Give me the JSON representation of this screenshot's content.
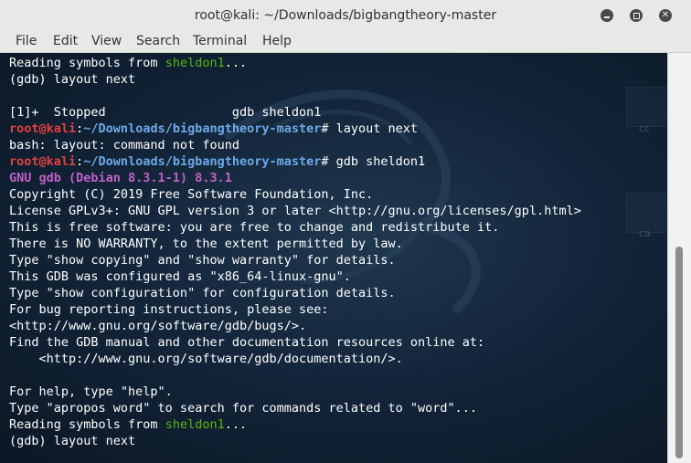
{
  "window": {
    "title": "root@kali: ~/Downloads/bigbangtheory-master",
    "controls": {
      "minimize_icon": "minimize-icon",
      "maximize_icon": "maximize-icon",
      "close_icon": "close-icon"
    }
  },
  "menu": {
    "items": [
      "File",
      "Edit",
      "View",
      "Search",
      "Terminal",
      "Help"
    ]
  },
  "desktop": {
    "labels": [
      "cc",
      "ca"
    ]
  },
  "terminal": {
    "lines": [
      [
        {
          "t": "Reading symbols from ",
          "c": "w"
        },
        {
          "t": "sheldon1",
          "c": "g"
        },
        {
          "t": "...",
          "c": "w"
        }
      ],
      [
        {
          "t": "(gdb) layout next",
          "c": "w"
        }
      ],
      [
        {
          "t": "",
          "c": "w"
        }
      ],
      [
        {
          "t": "[1]+  Stopped                 gdb sheldon1",
          "c": "w"
        }
      ],
      [
        {
          "t": "root@kali",
          "c": "r"
        },
        {
          "t": ":",
          "c": "w"
        },
        {
          "t": "~/Downloads/bigbangtheory-master",
          "c": "b"
        },
        {
          "t": "# layout next",
          "c": "w"
        }
      ],
      [
        {
          "t": "bash: layout: command not found",
          "c": "w"
        }
      ],
      [
        {
          "t": "root@kali",
          "c": "r"
        },
        {
          "t": ":",
          "c": "w"
        },
        {
          "t": "~/Downloads/bigbangtheory-master",
          "c": "b"
        },
        {
          "t": "# gdb sheldon1",
          "c": "w"
        }
      ],
      [
        {
          "t": "GNU gdb (Debian 8.3.1-1) 8.3.1",
          "c": "p"
        }
      ],
      [
        {
          "t": "Copyright (C) 2019 Free Software Foundation, Inc.",
          "c": "w"
        }
      ],
      [
        {
          "t": "License GPLv3+: GNU GPL version 3 or later <http://gnu.org/licenses/gpl.html>",
          "c": "w"
        }
      ],
      [
        {
          "t": "This is free software: you are free to change and redistribute it.",
          "c": "w"
        }
      ],
      [
        {
          "t": "There is NO WARRANTY, to the extent permitted by law.",
          "c": "w"
        }
      ],
      [
        {
          "t": "Type \"show copying\" and \"show warranty\" for details.",
          "c": "w"
        }
      ],
      [
        {
          "t": "This GDB was configured as \"x86_64-linux-gnu\".",
          "c": "w"
        }
      ],
      [
        {
          "t": "Type \"show configuration\" for configuration details.",
          "c": "w"
        }
      ],
      [
        {
          "t": "For bug reporting instructions, please see:",
          "c": "w"
        }
      ],
      [
        {
          "t": "<http://www.gnu.org/software/gdb/bugs/>.",
          "c": "w"
        }
      ],
      [
        {
          "t": "Find the GDB manual and other documentation resources online at:",
          "c": "w"
        }
      ],
      [
        {
          "t": "    <http://www.gnu.org/software/gdb/documentation/>.",
          "c": "w"
        }
      ],
      [
        {
          "t": "",
          "c": "w"
        }
      ],
      [
        {
          "t": "For help, type \"help\".",
          "c": "w"
        }
      ],
      [
        {
          "t": "Type \"apropos word\" to search for commands related to \"word\"...",
          "c": "w"
        }
      ],
      [
        {
          "t": "Reading symbols from ",
          "c": "w"
        },
        {
          "t": "sheldon1",
          "c": "g"
        },
        {
          "t": "...",
          "c": "w"
        }
      ],
      [
        {
          "t": "(gdb) layout next",
          "c": "w"
        }
      ]
    ]
  }
}
